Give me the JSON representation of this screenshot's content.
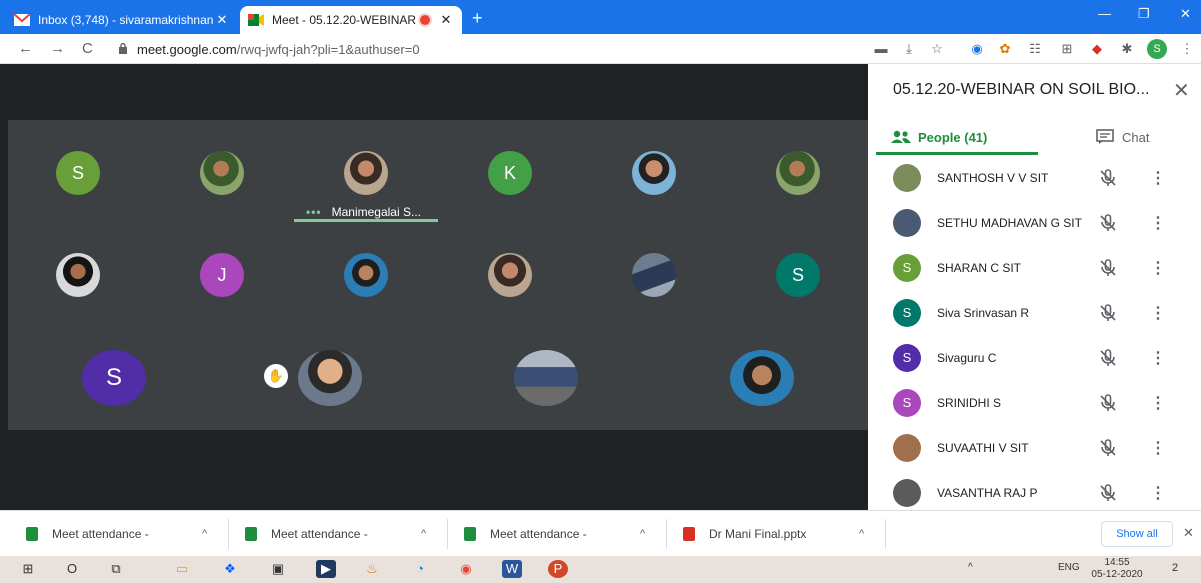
{
  "browser": {
    "tabs": [
      {
        "title": "Inbox (3,748) - sivaramakrishnan",
        "close": "✕"
      },
      {
        "title": "Meet - 05.12.20-WEBINAR O",
        "close": "✕"
      }
    ],
    "new_tab": "+",
    "window_controls": {
      "minimize": "—",
      "maximize": "❐",
      "close": "✕"
    },
    "nav": {
      "back": "←",
      "forward": "→",
      "reload": "C"
    },
    "url_host": "meet.google.com",
    "url_path": "/rwq-jwfq-jah?pli=1&authuser=0",
    "toolbar_icons": [
      "▬",
      "⤓",
      "☆",
      "◉",
      "✿",
      "☷",
      "⊞",
      "◆",
      "✱"
    ],
    "profile_initial": "S",
    "menu": "⋮"
  },
  "meet": {
    "tiles_row1": [
      "S",
      "",
      "",
      "K",
      "",
      ""
    ],
    "tiles_row2": [
      "",
      "J",
      "",
      "",
      "",
      "S"
    ],
    "tiles_row3": [
      "S",
      "",
      "",
      ""
    ],
    "active_speaker": "Manimegalai S...",
    "speaking_dots": "•••",
    "hand_icon": "✋"
  },
  "panel": {
    "title": "05.12.20-WEBINAR ON SOIL BIO...",
    "close": "✕",
    "people_tab": "People (41)",
    "chat_tab": "Chat",
    "participants": [
      {
        "name": "SANTHOSH V V SIT",
        "initial": "",
        "color": "#7c8b5a"
      },
      {
        "name": "SETHU MADHAVAN G SIT",
        "initial": "",
        "color": "#4a5a73"
      },
      {
        "name": "SHARAN C SIT",
        "initial": "S",
        "color": "#689f38"
      },
      {
        "name": "Siva Srinvasan R",
        "initial": "S",
        "color": "#00796b"
      },
      {
        "name": "Sivaguru C",
        "initial": "S",
        "color": "#512da8"
      },
      {
        "name": "SRINIDHI S",
        "initial": "S",
        "color": "#ab47bc"
      },
      {
        "name": "SUVAATHI V SIT",
        "initial": "",
        "color": "#a0704e"
      },
      {
        "name": "VASANTHA RAJ P",
        "initial": "",
        "color": "#5b5b5b"
      }
    ],
    "more_icon": "⋮"
  },
  "downloads": {
    "items": [
      {
        "name": "Meet attendance -",
        "color": "#1e8e3e"
      },
      {
        "name": "Meet attendance -",
        "color": "#1e8e3e"
      },
      {
        "name": "Meet attendance -",
        "color": "#1e8e3e"
      },
      {
        "name": "Dr Mani Final.pptx",
        "color": "#d93025"
      }
    ],
    "chevron": "^",
    "show_all": "Show all",
    "close": "✕"
  },
  "taskbar": {
    "start": "⊞",
    "search": "O",
    "taskview": "⧉",
    "apps": [
      "▭",
      "❖",
      "▣",
      "▶",
      "♨",
      "◔",
      "◉",
      "W",
      "P"
    ],
    "tray_up": "^",
    "language": "ENG",
    "time": "14:55",
    "date": "05-12-2020",
    "notifications": "2"
  }
}
